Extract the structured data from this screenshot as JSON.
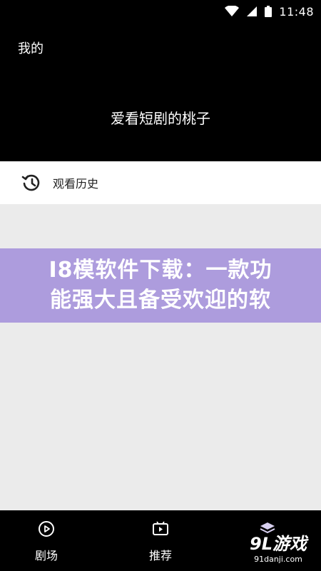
{
  "status_bar": {
    "time": "11:48"
  },
  "header": {
    "title": "我的",
    "username": "爱看短剧的桃子"
  },
  "history": {
    "label": "观看历史"
  },
  "banner": {
    "line1": "I8模软件下载：一款功",
    "line2": "能强大且备受欢迎的软"
  },
  "nav": [
    {
      "label": "剧场",
      "icon": "play-circle-icon"
    },
    {
      "label": "推荐",
      "icon": "video-icon"
    },
    {
      "label": "",
      "icon": "layers-icon"
    }
  ],
  "watermark": {
    "logo": "9L游戏",
    "site": "91danji.com"
  },
  "colors": {
    "header_bg": "#000000",
    "page_bg": "#ebebeb",
    "banner_bg": "#a896dc"
  }
}
